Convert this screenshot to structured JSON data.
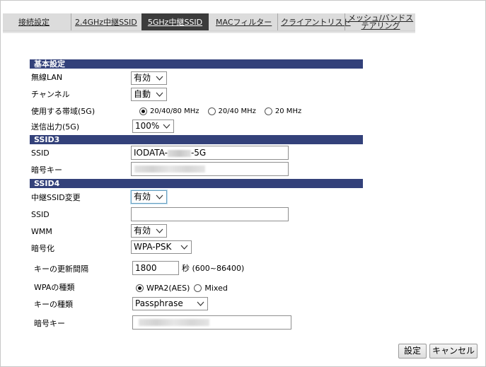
{
  "tabs": {
    "connection": "接続設定",
    "ssid24": "2.4GHz中継SSID",
    "ssid5": "5GHz中継SSID",
    "mac": "MACフィルター",
    "client": "クライアントリスト",
    "mesh": "メッシュ/バンドステアリング"
  },
  "basic": {
    "header": "基本設定",
    "wireless_label": "無線LAN",
    "wireless_value": "有効",
    "channel_label": "チャンネル",
    "channel_value": "自動",
    "band_label": "使用する帯域(5G)",
    "band_options": [
      "20/40/80 MHz",
      "20/40 MHz",
      "20 MHz"
    ],
    "power_label": "送信出力(5G)",
    "power_value": "100%"
  },
  "ssid3": {
    "header": "SSID3",
    "ssid_label": "SSID",
    "ssid_prefix": "IODATA-",
    "ssid_suffix": "-5G",
    "key_label": "暗号キー"
  },
  "ssid4": {
    "header": "SSID4",
    "relay_label": "中継SSID変更",
    "relay_value": "有効",
    "ssid_label": "SSID",
    "ssid_value": "",
    "wmm_label": "WMM",
    "wmm_value": "有効",
    "enc_label": "暗号化",
    "enc_value": "WPA-PSK",
    "interval_label": "キーの更新間隔",
    "interval_value": "1800",
    "interval_unit": "秒 (600~86400)",
    "wpa_label": "WPAの種類",
    "wpa_options": [
      "WPA2(AES)",
      "Mixed"
    ],
    "keytype_label": "キーの種類",
    "keytype_value": "Passphrase",
    "key_label": "暗号キー"
  },
  "buttons": {
    "apply": "設定",
    "cancel": "キャンセル"
  }
}
